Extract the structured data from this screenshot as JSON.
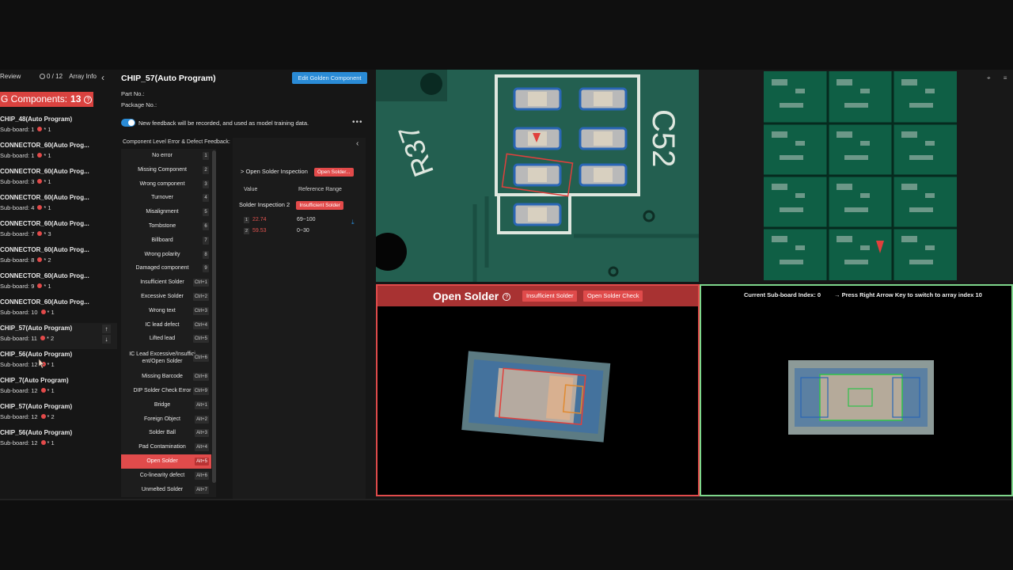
{
  "left_panel": {
    "tab_review": "Review",
    "array_info": {
      "progress": "0 / 12",
      "label": "Array Info"
    },
    "ng_header": {
      "label": "G Components:",
      "count": "13"
    },
    "items": [
      {
        "name": "CHIP_48(Auto Program)",
        "sub": "Sub-board: 1",
        "count": "* 1"
      },
      {
        "name": "CONNECTOR_60(Auto Prog...",
        "sub": "Sub-board: 1",
        "count": "* 1"
      },
      {
        "name": "CONNECTOR_60(Auto Prog...",
        "sub": "Sub-board: 3",
        "count": "* 1"
      },
      {
        "name": "CONNECTOR_60(Auto Prog...",
        "sub": "Sub-board: 4",
        "count": "* 1"
      },
      {
        "name": "CONNECTOR_60(Auto Prog...",
        "sub": "Sub-board: 7",
        "count": "* 3"
      },
      {
        "name": "CONNECTOR_60(Auto Prog...",
        "sub": "Sub-board: 8",
        "count": "* 2"
      },
      {
        "name": "CONNECTOR_60(Auto Prog...",
        "sub": "Sub-board: 9",
        "count": "* 1"
      },
      {
        "name": "CONNECTOR_60(Auto Prog...",
        "sub": "Sub-board: 10",
        "count": "* 1"
      },
      {
        "name": "CHIP_57(Auto Program)",
        "sub": "Sub-board: 11",
        "count": "* 2"
      },
      {
        "name": "CHIP_56(Auto Program)",
        "sub": "Sub-board: 12",
        "count": "* 1"
      },
      {
        "name": "CHIP_7(Auto Program)",
        "sub": "Sub-board: 12",
        "count": "* 1"
      },
      {
        "name": "CHIP_57(Auto Program)",
        "sub": "Sub-board: 12",
        "count": "* 2"
      },
      {
        "name": "CHIP_56(Auto Program)",
        "sub": "Sub-board: 12",
        "count": "* 1"
      }
    ]
  },
  "component": {
    "title": "CHIP_57(Auto Program)",
    "edit_button": "Edit Golden Component",
    "part_no": "Part No.:",
    "package_no": "Package No.:",
    "feedback_toggle": "New feedback will be recorded, and used as model training data.",
    "level_title": "Component Level Error & Defect Feedback:"
  },
  "defects": [
    {
      "label": "No error",
      "key": "1"
    },
    {
      "label": "Missing Component",
      "key": "2"
    },
    {
      "label": "Wrong component",
      "key": "3"
    },
    {
      "label": "Turnover",
      "key": "4"
    },
    {
      "label": "Misalignment",
      "key": "5"
    },
    {
      "label": "Tombstone",
      "key": "6"
    },
    {
      "label": "Billboard",
      "key": "7"
    },
    {
      "label": "Wrong polarity",
      "key": "8"
    },
    {
      "label": "Damaged component",
      "key": "9"
    },
    {
      "label": "Insufficient Solder",
      "key": "Ctrl+1"
    },
    {
      "label": "Excessive Solder",
      "key": "Ctrl+2"
    },
    {
      "label": "Wrong text",
      "key": "Ctrl+3"
    },
    {
      "label": "IC lead defect",
      "key": "Ctrl+4"
    },
    {
      "label": "Lifted lead",
      "key": "Ctrl+5"
    },
    {
      "label": "IC Lead Excessive/Insufficient/Open Solder",
      "key": "Ctrl+6"
    },
    {
      "label": "Missing Barcode",
      "key": "Ctrl+8"
    },
    {
      "label": "DIP Solder Check Error",
      "key": "Ctrl+9"
    },
    {
      "label": "Bridge",
      "key": "Alt+1"
    },
    {
      "label": "Foreign Object",
      "key": "Alt+2"
    },
    {
      "label": "Solder Ball",
      "key": "Alt+3"
    },
    {
      "label": "Pad Contamination",
      "key": "Alt+4"
    },
    {
      "label": "Open Solder",
      "key": "Alt+5"
    },
    {
      "label": "Co-linearity defect",
      "key": "Alt+6"
    },
    {
      "label": "Unmelted Solder",
      "key": "Alt+7"
    }
  ],
  "inspection": {
    "header": "Open Solder Inspection",
    "header_badge": "Open Solder...",
    "col_value": "Value",
    "col_range": "Reference Range",
    "row_label": "Solder Inspection 2",
    "row_badge": "Insufficient Solder",
    "values": [
      {
        "idx": "1",
        "value": "22.74",
        "range": "69~100"
      },
      {
        "idx": "2",
        "value": "59.53",
        "range": "0~30"
      }
    ]
  },
  "result": {
    "title": "Open Solder",
    "tags": [
      "Insufficient Solder",
      "Open Solder Check"
    ]
  },
  "golden": {
    "index_text": "Current Sub-board Index: 0",
    "hint": "Press Right Arrow Key to switch to array index 10"
  },
  "colors": {
    "ng_red": "#d9423f",
    "accent_blue": "#2a8bd6",
    "golden_green": "#7ed68b"
  }
}
